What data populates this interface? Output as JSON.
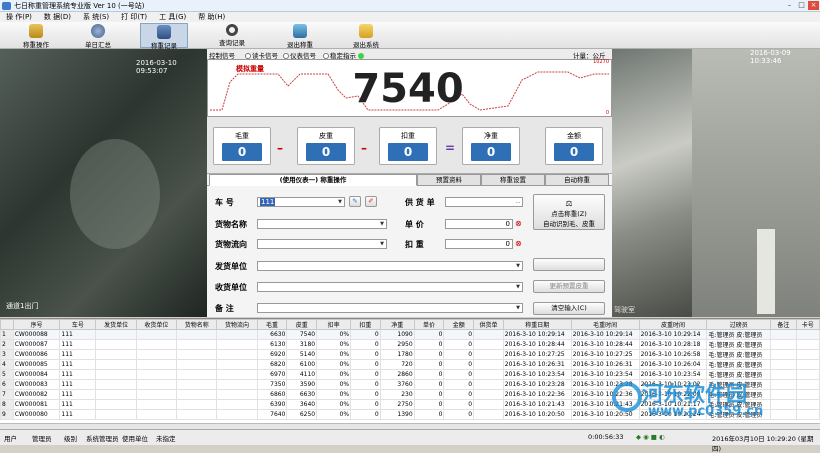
{
  "window": {
    "title": "七日称重管理系统专业版 Ver 10 (一号站)",
    "min": "–",
    "max": "□",
    "close": "×"
  },
  "menu": [
    "操 作(P)",
    "数 据(D)",
    "系 统(S)",
    "打 印(T)",
    "工 具(G)",
    "帮 助(H)"
  ],
  "toolbar": [
    {
      "label": "称重操作",
      "icon": "scale-icon"
    },
    {
      "label": "单日汇总",
      "icon": "disc-icon"
    },
    {
      "label": "称重记录",
      "icon": "record-icon"
    },
    {
      "label": "查询记录",
      "icon": "search-icon"
    },
    {
      "label": "退出称重",
      "icon": "exit-weigh-icon"
    },
    {
      "label": "退出系统",
      "icon": "exit-system-icon"
    }
  ],
  "camera_left": {
    "timestamp": "2016-03-10 09:53:07",
    "caption": "通道1出门"
  },
  "camera_right": {
    "timestamp": "2016-03-09 10:33:46",
    "caption": "驾驶室"
  },
  "signal": {
    "label": "控制信号",
    "opt1": "读卡信号",
    "opt2": "仪表信号",
    "opt3": "稳定指示",
    "unit": "计量：公斤"
  },
  "graph": {
    "label": "模拟重量",
    "weight": "7540",
    "scale_max": "10270",
    "scale_min": "0"
  },
  "values": [
    {
      "name": "毛重",
      "value": "0"
    },
    {
      "name": "皮重",
      "value": "0"
    },
    {
      "name": "扣重",
      "value": "0"
    },
    {
      "name": "净重",
      "value": "0"
    },
    {
      "name": "金额",
      "value": "0"
    }
  ],
  "ops": {
    "minus1": "–",
    "minus2": "–",
    "equals": "="
  },
  "tabs": [
    "(使用仪表一)  称重操作",
    "预置资料",
    "称重设置",
    "自动称重"
  ],
  "form": {
    "plate_label": "车   号",
    "plate_value": "111",
    "goods_label": "货物名称",
    "flow_label": "货物流向",
    "sender_label": "发货单位",
    "receiver_label": "收货单位",
    "note_label": "备   注",
    "supply_label": "供 货 单",
    "price_label": "单   价",
    "price_value": "0",
    "deduct_label": "扣   重",
    "deduct_value": "0",
    "btn_weigh": "点击称重(Z)",
    "btn_weigh2": "自动识别毛、皮重",
    "btn_preset": "更新预置皮重",
    "btn_clear": "清空输入(C)"
  },
  "table": {
    "headers": [
      "序号",
      "车号",
      "发货单位",
      "收货单位",
      "货物名称",
      "货物流向",
      "毛重",
      "皮重",
      "扣率",
      "扣重",
      "净重",
      "单价",
      "金额",
      "供货单",
      "称重日期",
      "毛重时间",
      "皮重时间",
      "过磅员",
      "备注",
      "卡号"
    ],
    "rows": [
      [
        "CW000088",
        "111",
        "",
        "",
        "",
        "",
        "6630",
        "7540",
        "0%",
        "0",
        "1090",
        "0",
        "0",
        "",
        "2016-3-10 10:29:14",
        "2016-3-10 10:29:14",
        "2016-3-10 10:29:14",
        "毛:管理员 皮:管理员"
      ],
      [
        "CW000087",
        "111",
        "",
        "",
        "",
        "",
        "6130",
        "3180",
        "0%",
        "0",
        "2950",
        "0",
        "0",
        "",
        "2016-3-10 10:28:44",
        "2016-3-10 10:28:44",
        "2016-3-10 10:28:18",
        "毛:管理员 皮:管理员"
      ],
      [
        "CW000086",
        "111",
        "",
        "",
        "",
        "",
        "6920",
        "5140",
        "0%",
        "0",
        "1780",
        "0",
        "0",
        "",
        "2016-3-10 10:27:25",
        "2016-3-10 10:27:25",
        "2016-3-10 10:26:58",
        "毛:管理员 皮:管理员"
      ],
      [
        "CW000085",
        "111",
        "",
        "",
        "",
        "",
        "6820",
        "6100",
        "0%",
        "0",
        "720",
        "0",
        "0",
        "",
        "2016-3-10 10:26:31",
        "2016-3-10 10:26:31",
        "2016-3-10 10:26:04",
        "毛:管理员 皮:管理员"
      ],
      [
        "CW000084",
        "111",
        "",
        "",
        "",
        "",
        "6970",
        "4110",
        "0%",
        "0",
        "2860",
        "0",
        "0",
        "",
        "2016-3-10 10:23:54",
        "2016-3-10 10:23:54",
        "2016-3-10 10:23:54",
        "毛:管理员 皮:管理员"
      ],
      [
        "CW000083",
        "111",
        "",
        "",
        "",
        "",
        "7350",
        "3590",
        "0%",
        "0",
        "3760",
        "0",
        "0",
        "",
        "2016-3-10 10:23:28",
        "2016-3-10 10:23:28",
        "2016-3-10 10:23:02",
        "毛:管理员 皮:管理员"
      ],
      [
        "CW000082",
        "111",
        "",
        "",
        "",
        "",
        "6860",
        "6630",
        "0%",
        "0",
        "230",
        "0",
        "0",
        "",
        "2016-3-10 10:22:36",
        "2016-3-10 10:22:36",
        "2016-3-10 10:22:09",
        "毛:管理员 皮:管理员"
      ],
      [
        "CW000081",
        "111",
        "",
        "",
        "",
        "",
        "6390",
        "3640",
        "0%",
        "0",
        "2750",
        "0",
        "0",
        "",
        "2016-3-10 10:21:43",
        "2016-3-10 10:21:43",
        "2016-3-10 10:21:17",
        "毛:管理员 皮:管理员"
      ],
      [
        "CW000080",
        "111",
        "",
        "",
        "",
        "",
        "7640",
        "6250",
        "0%",
        "0",
        "1390",
        "0",
        "0",
        "",
        "2016-3-10 10:20:50",
        "2016-3-10 10:20:50",
        "2016-3-10 10:20:24",
        "毛:管理员 皮:管理员"
      ]
    ]
  },
  "status": {
    "user_label": "用户",
    "user": "管理员",
    "level_label": "级别",
    "level": "系统管理员",
    "unit_label": "使用单位",
    "unit": "未指定",
    "elapsed": "0:00:56:33",
    "datetime": "2016年03月10日  10:29:20 (星期四)"
  },
  "watermark": {
    "line1": "河东软件园",
    "line2": "www.pc0359.cn"
  }
}
